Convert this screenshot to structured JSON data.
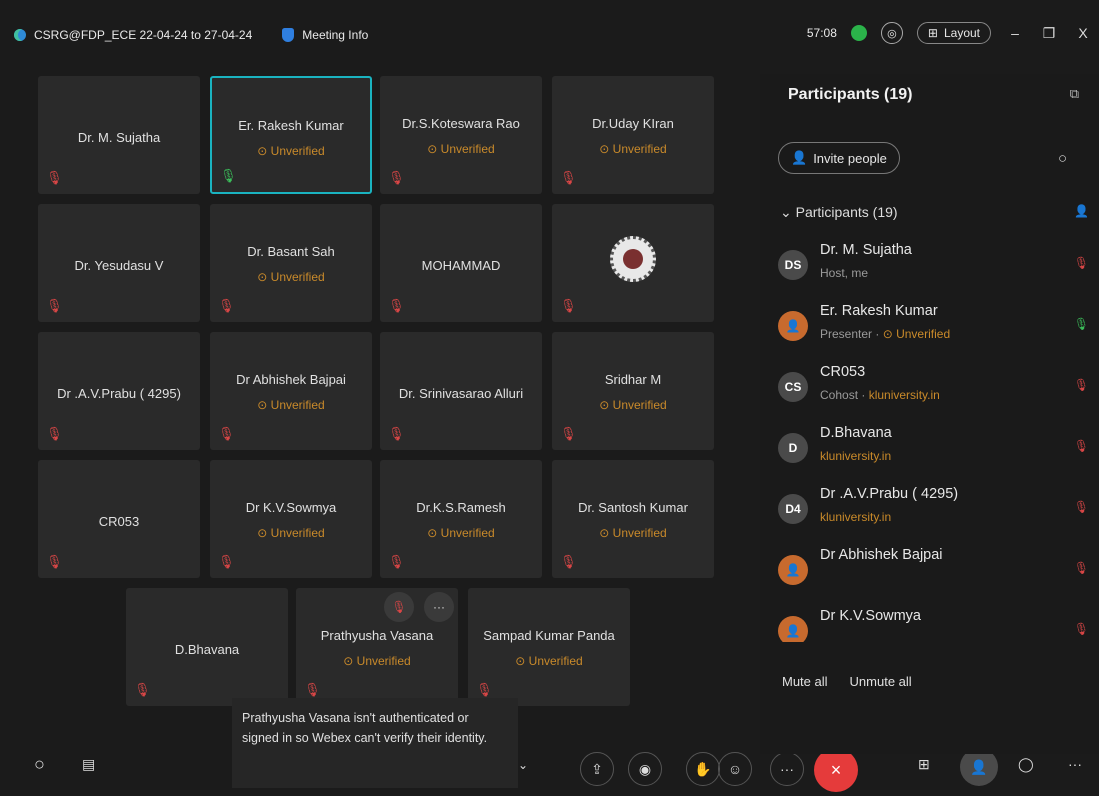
{
  "titlebar": {
    "meeting_name": "CSRG@FDP_ECE 22-04-24 to 27-04-24",
    "meeting_info": "Meeting Info",
    "timer": "57:08",
    "layout_label": "Layout",
    "minimize": "–",
    "restore": "❐",
    "close": "X"
  },
  "tiles": [
    {
      "name": "Dr. M. Sujatha",
      "unverified": "",
      "mic": "muted"
    },
    {
      "name": "Er. Rakesh Kumar",
      "unverified": "Unverified",
      "mic": "on"
    },
    {
      "name": "Dr.S.Koteswara Rao",
      "unverified": "Unverified",
      "mic": "muted"
    },
    {
      "name": "Dr.Uday KIran",
      "unverified": "Unverified",
      "mic": "muted"
    },
    {
      "name": "Dr. Yesudasu V",
      "unverified": "",
      "mic": "muted"
    },
    {
      "name": "Dr. Basant Sah",
      "unverified": "Unverified",
      "mic": "muted"
    },
    {
      "name": "MOHAMMAD",
      "unverified": "",
      "mic": "muted"
    },
    {
      "name": "",
      "unverified": "",
      "mic": "muted"
    },
    {
      "name": "Dr .A.V.Prabu ( 4295)",
      "unverified": "",
      "mic": "muted"
    },
    {
      "name": "Dr Abhishek Bajpai",
      "unverified": "Unverified",
      "mic": "muted"
    },
    {
      "name": "Dr. Srinivasarao Alluri",
      "unverified": "",
      "mic": "muted"
    },
    {
      "name": "Sridhar M",
      "unverified": "Unverified",
      "mic": "muted"
    },
    {
      "name": "CR053",
      "unverified": "",
      "mic": "muted"
    },
    {
      "name": "Dr K.V.Sowmya",
      "unverified": "Unverified",
      "mic": "muted"
    },
    {
      "name": "Dr.K.S.Ramesh",
      "unverified": "Unverified",
      "mic": "muted"
    },
    {
      "name": "Dr. Santosh Kumar",
      "unverified": "Unverified",
      "mic": "muted"
    },
    {
      "name": "D.Bhavana",
      "unverified": "",
      "mic": "muted"
    },
    {
      "name": "Prathyusha Vasana",
      "unverified": "Unverified",
      "mic": "muted"
    },
    {
      "name": "Sampad Kumar Panda",
      "unverified": "Unverified",
      "mic": "muted"
    }
  ],
  "tooltip": "Prathyusha Vasana isn't authenticated or signed in so Webex can't verify their identity.",
  "panel": {
    "title": "Participants (19)",
    "invite": "Invite people",
    "section": "Participants (19)",
    "participants": [
      {
        "initials": "DS",
        "name": "Dr. M. Sujatha",
        "role": "Host, me",
        "org": "",
        "mic": "muted"
      },
      {
        "initials": "",
        "name": "Er. Rakesh Kumar",
        "role": "Presenter · ",
        "org": "Unverified",
        "mic": "on"
      },
      {
        "initials": "CS",
        "name": "CR053",
        "role": "Cohost · ",
        "org": "kluniversity.in",
        "mic": "muted"
      },
      {
        "initials": "D",
        "name": "D.Bhavana",
        "role": "",
        "org": "kluniversity.in",
        "mic": "muted"
      },
      {
        "initials": "D4",
        "name": "Dr .A.V.Prabu ( 4295)",
        "role": "",
        "org": "kluniversity.in",
        "mic": "muted"
      },
      {
        "initials": "",
        "name": "Dr Abhishek Bajpai",
        "role": "",
        "org": "",
        "mic": "muted"
      },
      {
        "initials": "",
        "name": "Dr K.V.Sowmya",
        "role": "",
        "org": "",
        "mic": "muted"
      }
    ],
    "mute_all": "Mute all",
    "unmute_all": "Unmute all"
  },
  "toolbar": {
    "leave": "×",
    "more": "···"
  },
  "colors": {
    "accent": "#1ab3c0",
    "unverified": "#c98a2a",
    "leave": "#e53b3b",
    "muted": "#d94646"
  }
}
